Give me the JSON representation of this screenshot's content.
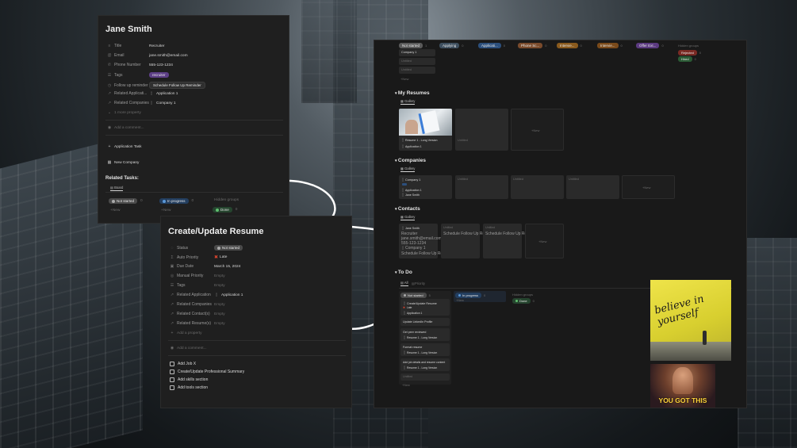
{
  "contact": {
    "title": "Jane Smith",
    "props": [
      {
        "icon": "text-icon",
        "label": "Title",
        "value": "Recruiter"
      },
      {
        "icon": "at-icon",
        "label": "Email",
        "value": "jane.smith@email.com"
      },
      {
        "icon": "phone-icon",
        "label": "Phone Number",
        "value": "555-123-1234"
      },
      {
        "icon": "list-icon",
        "label": "Tags",
        "value": "recruiter"
      },
      {
        "icon": "clock-icon",
        "label": "Follow up reminder",
        "value": "Schedule Follow Up Reminder"
      },
      {
        "icon": "arrow-icon",
        "label": "Related Applicati...",
        "value": "Application 1"
      },
      {
        "icon": "arrow-icon",
        "label": "Related Companies",
        "value": "Company 1"
      }
    ],
    "more_property": "1 more property",
    "add_comment": "Add a comment...",
    "app_task": "Application Task",
    "new_company": "New Company",
    "related_tasks": "Related Tasks:",
    "board_tab": "Board",
    "groups": [
      "Not started",
      "In progress",
      "Hidden groups"
    ],
    "counts": [
      "0",
      "0"
    ],
    "done": "Done",
    "done_count": "0",
    "new": "New"
  },
  "resume": {
    "title": "Create/Update Resume",
    "props": [
      {
        "icon": "status-icon",
        "label": "Status",
        "value": "Not started"
      },
      {
        "icon": "formula-icon",
        "label": "Auto Priority",
        "value": "Late"
      },
      {
        "icon": "calendar-icon",
        "label": "Due Date",
        "value": "March 15, 2024"
      },
      {
        "icon": "select-icon",
        "label": "Manual Priority",
        "value": "Empty"
      },
      {
        "icon": "list-icon",
        "label": "Tags",
        "value": "Empty"
      },
      {
        "icon": "arrow-icon",
        "label": "Related Application",
        "value": "Application 1"
      },
      {
        "icon": "arrow-icon",
        "label": "Related Companies",
        "value": "Empty"
      },
      {
        "icon": "arrow-icon",
        "label": "Related Contact(s)",
        "value": "Empty"
      },
      {
        "icon": "arrow-icon",
        "label": "Related Resume(s)",
        "value": "Empty"
      }
    ],
    "add_property": "Add a property",
    "add_comment": "Add a comment...",
    "todos": [
      "Add Job X",
      "Create/Update Professional Summary",
      "Add skills section",
      "Add tools section"
    ]
  },
  "dashboard": {
    "top_groups": [
      {
        "label": "Not started",
        "count": "1",
        "color": "#5a5a5a"
      },
      {
        "label": "Applying",
        "count": "0",
        "color": "#3e4f5f"
      },
      {
        "label": "Applicati...",
        "count": "0",
        "color": "#2c4f7c"
      },
      {
        "label": "Phone Sc...",
        "count": "0",
        "color": "#7a4b2c"
      },
      {
        "label": "Intervie...",
        "count": "0",
        "color": "#8a5a1d"
      },
      {
        "label": "Intervie...",
        "count": "0",
        "color": "#7a4a1a"
      },
      {
        "label": "Offer Ext...",
        "count": "0",
        "color": "#5b3a80"
      }
    ],
    "hidden_groups": "Hidden groups",
    "rejected": "Rejected",
    "hired": "Hired",
    "zero": "0",
    "company1": "Company 1",
    "untitled": "Untitled",
    "new": "New",
    "my_resumes": "My Resumes",
    "gallery": "Gallery",
    "resume_card": "Resume 1 - Long Version",
    "application1": "Application 1",
    "companies": "Companies",
    "contacts": "Contacts",
    "contact_card": {
      "name": "Jane Smith",
      "title": "Recruiter",
      "email": "jane.smith@email.com",
      "phone": "555-123-1234",
      "company": "Company 1",
      "reminder": "Schedule Follow Up Reminder"
    },
    "reminder": "Schedule Follow Up Reminder",
    "todo": "To Do",
    "all_tab": "All",
    "priority_tab": "Priority",
    "not_started": "Not started",
    "ns_count": "5",
    "in_progress": "In progress",
    "ip_count": "0",
    "done": "Done",
    "done_count": "0",
    "late": "Late",
    "tasks": [
      {
        "title": "Create/Update Resume",
        "extra": "Late",
        "sub": "Application 1"
      },
      {
        "title": "Update LinkedIn Profile",
        "extra": "",
        "sub": ""
      },
      {
        "title": "Get peer reviewed",
        "extra": "",
        "sub": "Resume 1 - Long Version"
      },
      {
        "title": "Format resume",
        "extra": "",
        "sub": "Resume 1 - Long Version"
      },
      {
        "title": "Add job details and resume content",
        "extra": "",
        "sub": "Resume 1 - Long Version"
      }
    ]
  },
  "images": {
    "believe_text": "believe in yourself",
    "gif_caption": "YOU GOT THIS"
  }
}
